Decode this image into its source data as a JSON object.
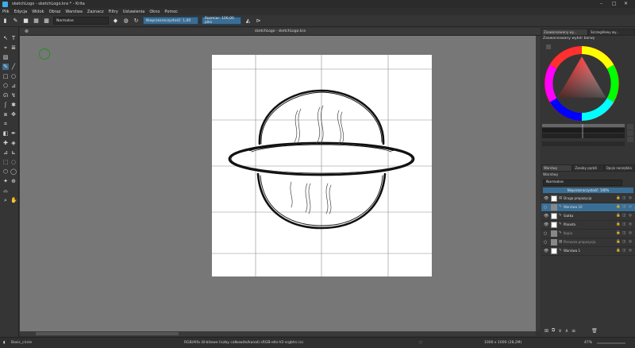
{
  "window": {
    "title": "sketchLogo - sketchLogo.kra * - Krita",
    "controls": [
      "–",
      "□",
      "✕"
    ]
  },
  "menu": [
    "Plik",
    "Edycja",
    "Widok",
    "Obraz",
    "Warstwa",
    "Zaznacz",
    "Filtry",
    "Ustawienia",
    "Okno",
    "Pomoc"
  ],
  "toolbar": {
    "blend_mode": "Normalne",
    "opacity_label": "Nieprzezroczystość:  1,00",
    "size_label": "Rozmiar:  100,00 piks"
  },
  "document": {
    "tab_title": "sketchLogo - sketchLogo.kra"
  },
  "dock": {
    "top_tabs": [
      "Zaawansowany wy...",
      "Szczegółowy wy..."
    ],
    "selector_header": "Zaawansowany wybór barwy",
    "layer_tabs": [
      "Warstwy",
      "Zasoby pędzli",
      "Opcje narzędzia"
    ],
    "layers_header": "Warstwy",
    "blend_mode": "Normalne",
    "opacity": "Nieprzezroczystość:  100%",
    "layers": [
      {
        "name": "Druga propozycja",
        "selected": false,
        "dim": false
      },
      {
        "name": "Warstwa 10",
        "selected": true,
        "dim": false
      },
      {
        "name": "Siatka",
        "selected": false,
        "dim": false
      },
      {
        "name": "Planeta",
        "selected": false,
        "dim": false
      },
      {
        "name": "Kopia",
        "selected": false,
        "dim": true
      },
      {
        "name": "Pierwsza propozycja",
        "selected": false,
        "dim": true
      },
      {
        "name": "Warstwa 1",
        "selected": false,
        "dim": false
      }
    ]
  },
  "status": {
    "brush": "Basic_circle",
    "color_model": "RGB/Alfa (8-bitowe liczby całkowite/kanał)  sRGB-elle-V2-srgbtrc.icc",
    "dimensions": "1000 x 1000 (28,2M)",
    "zoom": "47%"
  },
  "colors": {
    "accent": "#3a6e95",
    "canvas_bg": "#777777",
    "panel_bg": "#353535"
  }
}
